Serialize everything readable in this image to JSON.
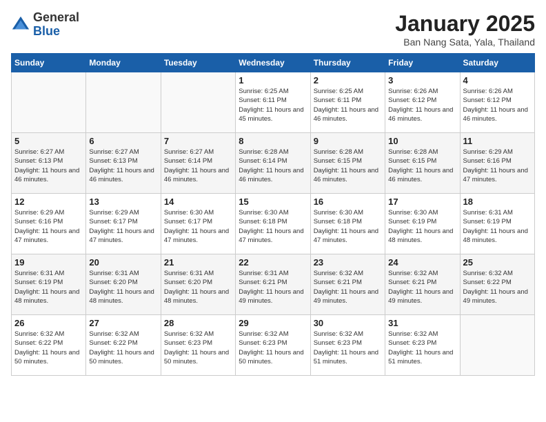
{
  "logo": {
    "general": "General",
    "blue": "Blue"
  },
  "title": "January 2025",
  "location": "Ban Nang Sata, Yala, Thailand",
  "days_of_week": [
    "Sunday",
    "Monday",
    "Tuesday",
    "Wednesday",
    "Thursday",
    "Friday",
    "Saturday"
  ],
  "weeks": [
    [
      {
        "day": "",
        "sunrise": "",
        "sunset": "",
        "daylight": ""
      },
      {
        "day": "",
        "sunrise": "",
        "sunset": "",
        "daylight": ""
      },
      {
        "day": "",
        "sunrise": "",
        "sunset": "",
        "daylight": ""
      },
      {
        "day": "1",
        "sunrise": "Sunrise: 6:25 AM",
        "sunset": "Sunset: 6:11 PM",
        "daylight": "Daylight: 11 hours and 45 minutes."
      },
      {
        "day": "2",
        "sunrise": "Sunrise: 6:25 AM",
        "sunset": "Sunset: 6:11 PM",
        "daylight": "Daylight: 11 hours and 46 minutes."
      },
      {
        "day": "3",
        "sunrise": "Sunrise: 6:26 AM",
        "sunset": "Sunset: 6:12 PM",
        "daylight": "Daylight: 11 hours and 46 minutes."
      },
      {
        "day": "4",
        "sunrise": "Sunrise: 6:26 AM",
        "sunset": "Sunset: 6:12 PM",
        "daylight": "Daylight: 11 hours and 46 minutes."
      }
    ],
    [
      {
        "day": "5",
        "sunrise": "Sunrise: 6:27 AM",
        "sunset": "Sunset: 6:13 PM",
        "daylight": "Daylight: 11 hours and 46 minutes."
      },
      {
        "day": "6",
        "sunrise": "Sunrise: 6:27 AM",
        "sunset": "Sunset: 6:13 PM",
        "daylight": "Daylight: 11 hours and 46 minutes."
      },
      {
        "day": "7",
        "sunrise": "Sunrise: 6:27 AM",
        "sunset": "Sunset: 6:14 PM",
        "daylight": "Daylight: 11 hours and 46 minutes."
      },
      {
        "day": "8",
        "sunrise": "Sunrise: 6:28 AM",
        "sunset": "Sunset: 6:14 PM",
        "daylight": "Daylight: 11 hours and 46 minutes."
      },
      {
        "day": "9",
        "sunrise": "Sunrise: 6:28 AM",
        "sunset": "Sunset: 6:15 PM",
        "daylight": "Daylight: 11 hours and 46 minutes."
      },
      {
        "day": "10",
        "sunrise": "Sunrise: 6:28 AM",
        "sunset": "Sunset: 6:15 PM",
        "daylight": "Daylight: 11 hours and 46 minutes."
      },
      {
        "day": "11",
        "sunrise": "Sunrise: 6:29 AM",
        "sunset": "Sunset: 6:16 PM",
        "daylight": "Daylight: 11 hours and 47 minutes."
      }
    ],
    [
      {
        "day": "12",
        "sunrise": "Sunrise: 6:29 AM",
        "sunset": "Sunset: 6:16 PM",
        "daylight": "Daylight: 11 hours and 47 minutes."
      },
      {
        "day": "13",
        "sunrise": "Sunrise: 6:29 AM",
        "sunset": "Sunset: 6:17 PM",
        "daylight": "Daylight: 11 hours and 47 minutes."
      },
      {
        "day": "14",
        "sunrise": "Sunrise: 6:30 AM",
        "sunset": "Sunset: 6:17 PM",
        "daylight": "Daylight: 11 hours and 47 minutes."
      },
      {
        "day": "15",
        "sunrise": "Sunrise: 6:30 AM",
        "sunset": "Sunset: 6:18 PM",
        "daylight": "Daylight: 11 hours and 47 minutes."
      },
      {
        "day": "16",
        "sunrise": "Sunrise: 6:30 AM",
        "sunset": "Sunset: 6:18 PM",
        "daylight": "Daylight: 11 hours and 47 minutes."
      },
      {
        "day": "17",
        "sunrise": "Sunrise: 6:30 AM",
        "sunset": "Sunset: 6:19 PM",
        "daylight": "Daylight: 11 hours and 48 minutes."
      },
      {
        "day": "18",
        "sunrise": "Sunrise: 6:31 AM",
        "sunset": "Sunset: 6:19 PM",
        "daylight": "Daylight: 11 hours and 48 minutes."
      }
    ],
    [
      {
        "day": "19",
        "sunrise": "Sunrise: 6:31 AM",
        "sunset": "Sunset: 6:19 PM",
        "daylight": "Daylight: 11 hours and 48 minutes."
      },
      {
        "day": "20",
        "sunrise": "Sunrise: 6:31 AM",
        "sunset": "Sunset: 6:20 PM",
        "daylight": "Daylight: 11 hours and 48 minutes."
      },
      {
        "day": "21",
        "sunrise": "Sunrise: 6:31 AM",
        "sunset": "Sunset: 6:20 PM",
        "daylight": "Daylight: 11 hours and 48 minutes."
      },
      {
        "day": "22",
        "sunrise": "Sunrise: 6:31 AM",
        "sunset": "Sunset: 6:21 PM",
        "daylight": "Daylight: 11 hours and 49 minutes."
      },
      {
        "day": "23",
        "sunrise": "Sunrise: 6:32 AM",
        "sunset": "Sunset: 6:21 PM",
        "daylight": "Daylight: 11 hours and 49 minutes."
      },
      {
        "day": "24",
        "sunrise": "Sunrise: 6:32 AM",
        "sunset": "Sunset: 6:21 PM",
        "daylight": "Daylight: 11 hours and 49 minutes."
      },
      {
        "day": "25",
        "sunrise": "Sunrise: 6:32 AM",
        "sunset": "Sunset: 6:22 PM",
        "daylight": "Daylight: 11 hours and 49 minutes."
      }
    ],
    [
      {
        "day": "26",
        "sunrise": "Sunrise: 6:32 AM",
        "sunset": "Sunset: 6:22 PM",
        "daylight": "Daylight: 11 hours and 50 minutes."
      },
      {
        "day": "27",
        "sunrise": "Sunrise: 6:32 AM",
        "sunset": "Sunset: 6:22 PM",
        "daylight": "Daylight: 11 hours and 50 minutes."
      },
      {
        "day": "28",
        "sunrise": "Sunrise: 6:32 AM",
        "sunset": "Sunset: 6:23 PM",
        "daylight": "Daylight: 11 hours and 50 minutes."
      },
      {
        "day": "29",
        "sunrise": "Sunrise: 6:32 AM",
        "sunset": "Sunset: 6:23 PM",
        "daylight": "Daylight: 11 hours and 50 minutes."
      },
      {
        "day": "30",
        "sunrise": "Sunrise: 6:32 AM",
        "sunset": "Sunset: 6:23 PM",
        "daylight": "Daylight: 11 hours and 51 minutes."
      },
      {
        "day": "31",
        "sunrise": "Sunrise: 6:32 AM",
        "sunset": "Sunset: 6:23 PM",
        "daylight": "Daylight: 11 hours and 51 minutes."
      },
      {
        "day": "",
        "sunrise": "",
        "sunset": "",
        "daylight": ""
      }
    ]
  ]
}
